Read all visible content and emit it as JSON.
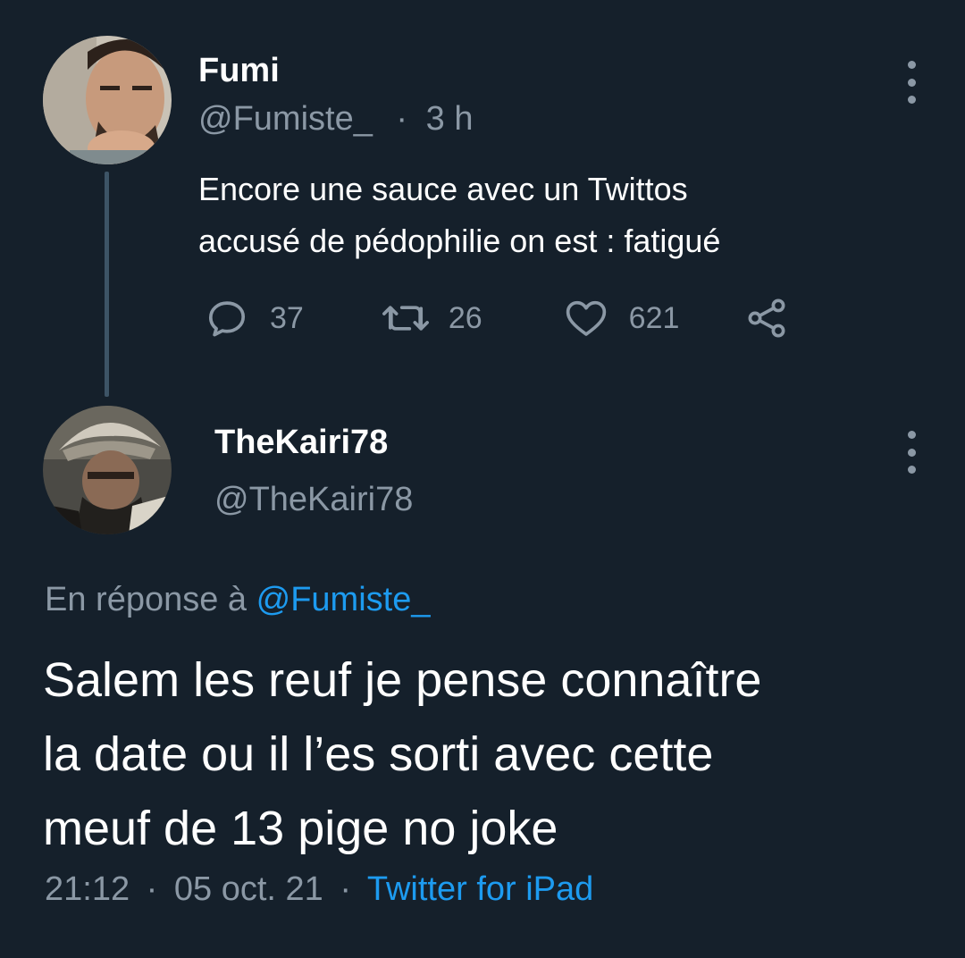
{
  "parent_tweet": {
    "author_name": "Fumi",
    "author_handle": "@Fumiste_",
    "time_separator": "·",
    "time_ago": "3 h",
    "text_line1": "Encore une sauce avec un Twittos",
    "text_line2": "accusé de pédophilie on est : fatigué",
    "replies": "37",
    "retweets": "26",
    "likes": "621",
    "icons": [
      "reply-icon",
      "retweet-icon",
      "like-icon",
      "share-icon",
      "more-options-icon"
    ]
  },
  "main_tweet": {
    "author_name": "TheKairi78",
    "author_handle": "@TheKairi78",
    "reply_prefix": "En réponse à",
    "reply_to_handle": "@Fumiste_",
    "text_line1": "Salem les reuf je pense connaître",
    "text_line2": "la date ou il l’es sorti avec cette",
    "text_line3": "meuf de 13 pige no joke",
    "time": "21:12",
    "date": "05 oct. 21",
    "separator": "·",
    "source": "Twitter for iPad"
  },
  "colors": {
    "background": "#15202b",
    "primary_text": "#ffffff",
    "secondary_text": "#8b98a5",
    "link": "#1d9bf0",
    "thread_line": "#3d5466"
  }
}
